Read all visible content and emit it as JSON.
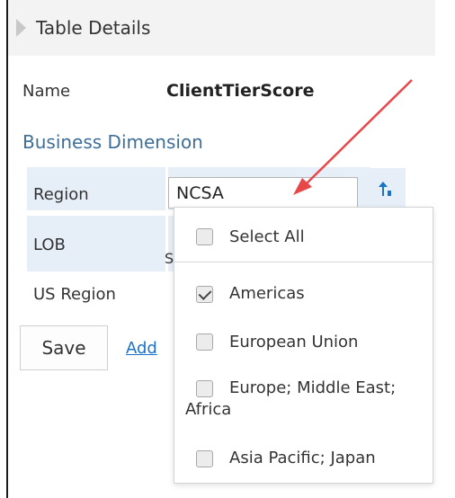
{
  "header": {
    "title": "Table Details"
  },
  "details": {
    "name_label": "Name",
    "name_value": "ClientTierScore",
    "section_title": "Business Dimension"
  },
  "dimensions": {
    "region": {
      "label": "Region",
      "value": "NCSA"
    },
    "lob": {
      "label": "LOB",
      "partial_value": "S"
    },
    "us_region": {
      "label": "US Region"
    }
  },
  "actions": {
    "save_label": "Save",
    "add_link": "Add"
  },
  "dropdown": {
    "select_all": {
      "label": "Select All",
      "checked": false
    },
    "options": [
      {
        "label": "Americas",
        "checked": true
      },
      {
        "label": "European Union",
        "checked": false
      },
      {
        "label": "Europe; Middle East; Africa",
        "checked": false
      },
      {
        "label": "Asia Pacific; Japan",
        "checked": false
      }
    ]
  },
  "colors": {
    "accent": "#3f6e96",
    "row_highlight": "#e6eff8",
    "link": "#1a73c8",
    "annotation_arrow": "#e8474a",
    "sort_icon": "#1a73c8"
  },
  "icons": {
    "header": "triangle-right-icon",
    "sort": "sort-up-icon",
    "annotation": "arrow-annotation-icon"
  }
}
